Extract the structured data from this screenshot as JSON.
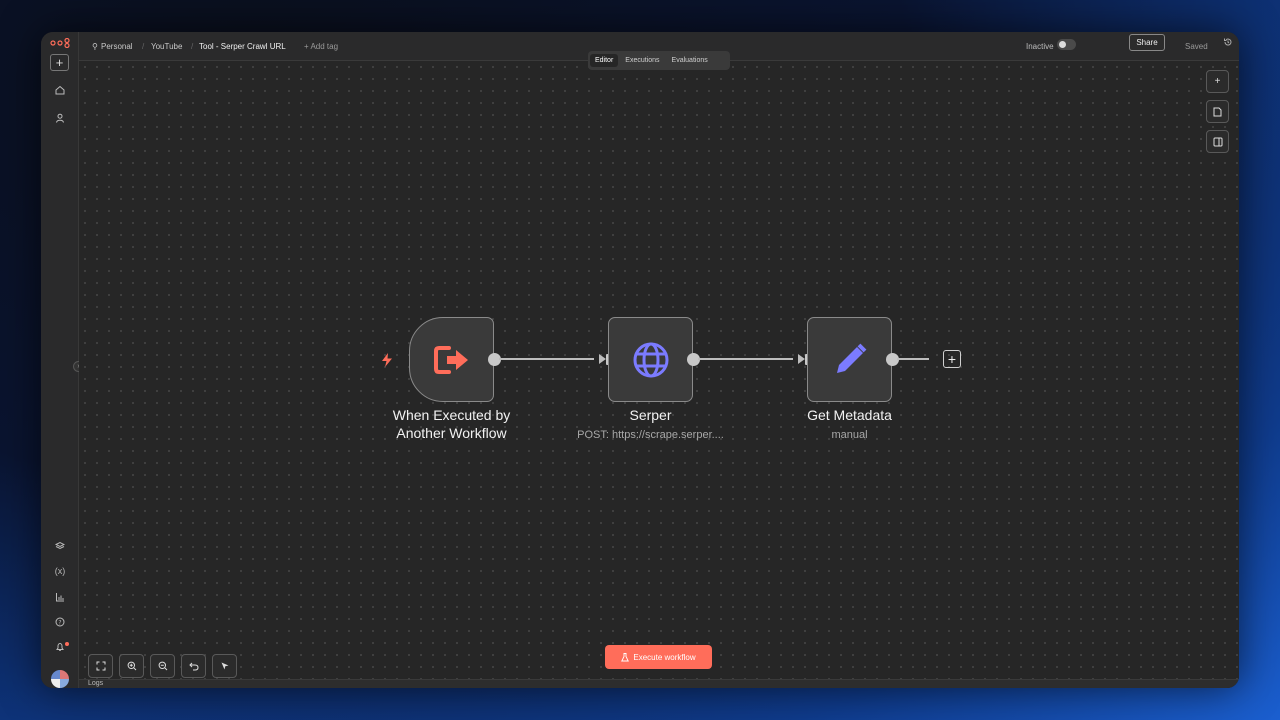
{
  "header": {
    "project": "Personal",
    "folder": "YouTube",
    "workflow_title": "Tool - Serper Crawl URL",
    "add_tag": "+ Add tag",
    "status_label": "Inactive",
    "share_label": "Share",
    "saved_label": "Saved"
  },
  "tabs": [
    {
      "label": "Editor",
      "active": true
    },
    {
      "label": "Executions",
      "active": false
    },
    {
      "label": "Evaluations",
      "active": false
    }
  ],
  "nodes": [
    {
      "label_line1": "When Executed by",
      "label_line2": "Another Workflow",
      "subtitle": "",
      "icon": "sign-in-icon",
      "color": "#ff6d5a"
    },
    {
      "label_line1": "Serper",
      "subtitle": "POST: https://scrape.serper....",
      "icon": "globe-icon",
      "color": "#7b7bff"
    },
    {
      "label_line1": "Get Metadata",
      "subtitle": "manual",
      "icon": "pencil-icon",
      "color": "#7b7bff"
    }
  ],
  "execute_button": "Execute workflow",
  "logs_label": "Logs",
  "colors": {
    "accent": "#ff6d5a",
    "node_icon": "#7b7bff",
    "canvas": "#262626"
  }
}
